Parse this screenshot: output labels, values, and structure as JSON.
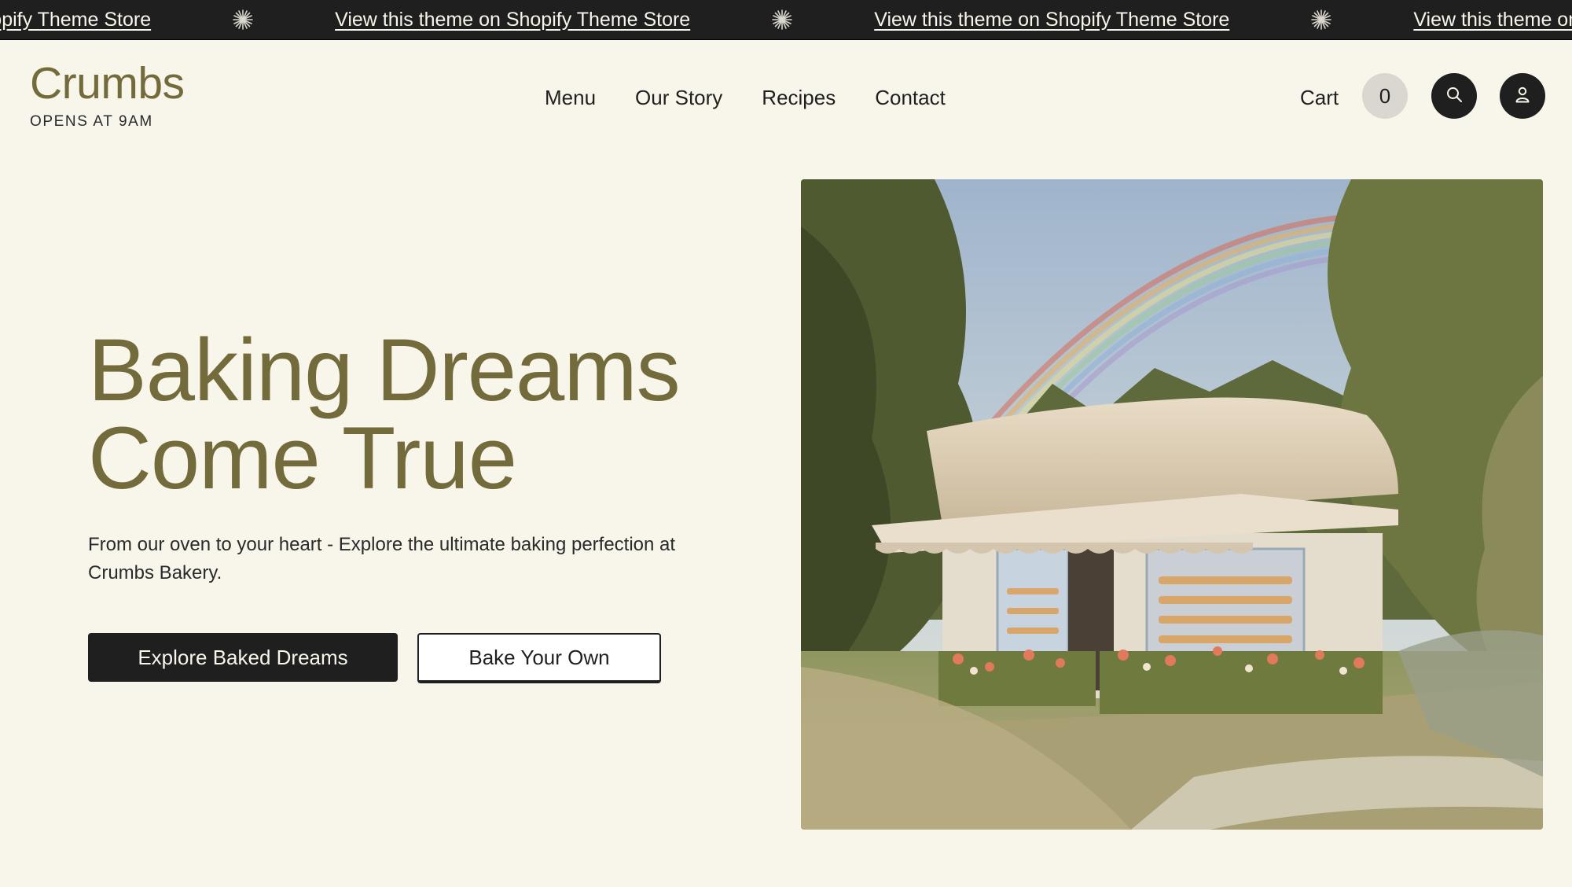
{
  "announcement": {
    "link_label": "View this theme on Shopify Theme Store",
    "separator_icon": "sparkle-icon"
  },
  "header": {
    "logo": "Crumbs",
    "tagline": "OPENS AT 9AM",
    "nav": [
      {
        "label": "Menu"
      },
      {
        "label": "Our Story"
      },
      {
        "label": "Recipes"
      },
      {
        "label": "Contact"
      }
    ],
    "cart_label": "Cart",
    "cart_count": "0",
    "search_icon": "search-icon",
    "account_icon": "account-icon"
  },
  "hero": {
    "title_line1": "Baking Dreams",
    "title_line2": "Come True",
    "subtitle": "From our oven to your heart - Explore the ultimate baking perfection at Crumbs Bakery.",
    "primary_button": "Explore Baked Dreams",
    "secondary_button": "Bake Your Own",
    "image_alt": "Small bakery shop with awning under a rainbow surrounded by trees"
  },
  "colors": {
    "background": "#f8f5eb",
    "brand_olive": "#736b3b",
    "dark": "#1f1f1f",
    "cart_badge": "#d9d7cf"
  }
}
